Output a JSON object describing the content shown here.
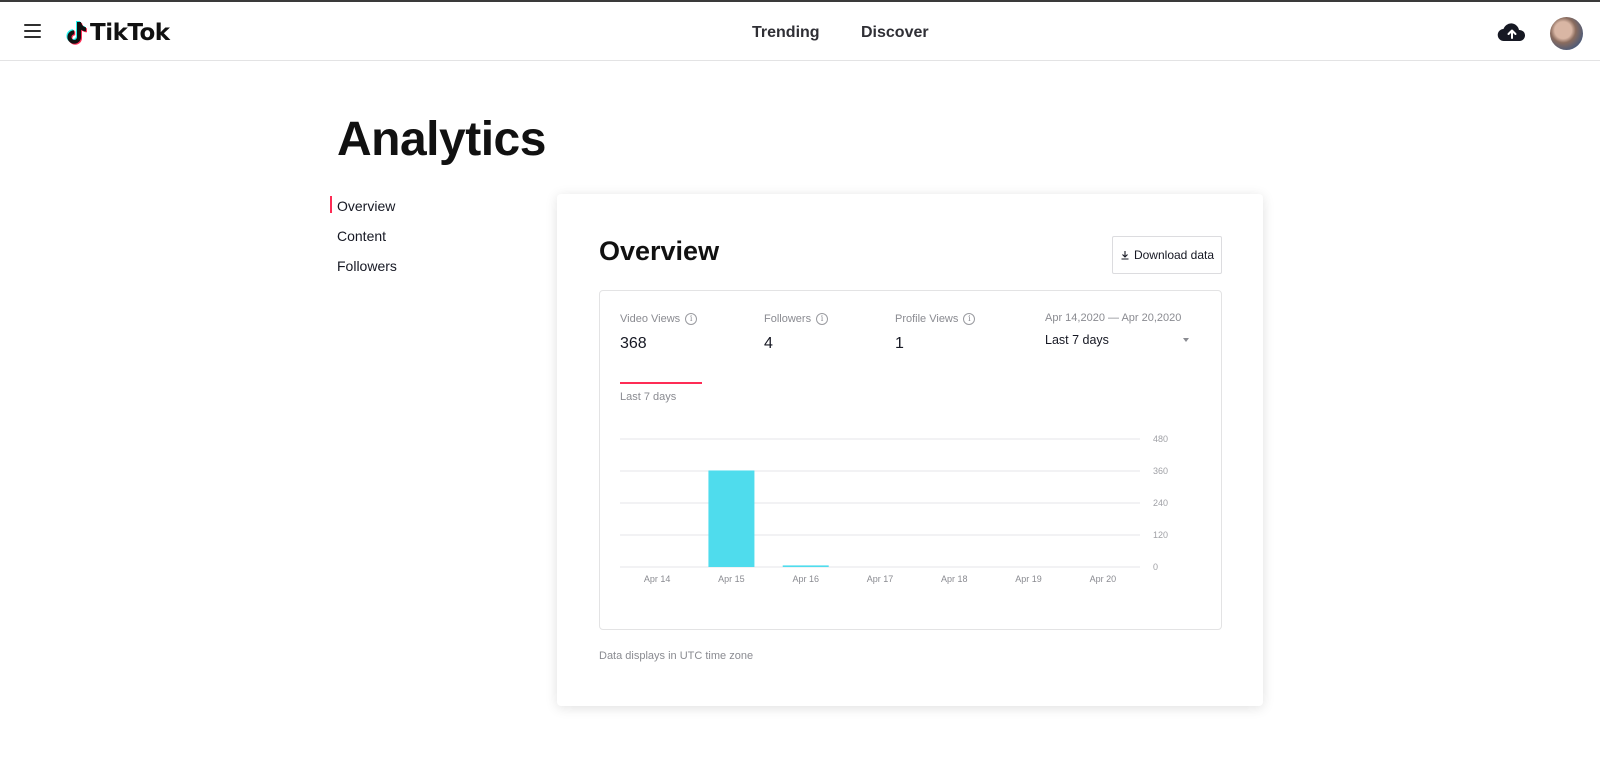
{
  "header": {
    "logo_text": "TikTok",
    "nav": {
      "trending": "Trending",
      "discover": "Discover"
    }
  },
  "page_title": "Analytics",
  "side_nav": {
    "overview": "Overview",
    "content": "Content",
    "followers": "Followers"
  },
  "card": {
    "title": "Overview",
    "download_label": "Download data",
    "metrics": {
      "video_views": {
        "label": "Video Views",
        "value": "368"
      },
      "followers": {
        "label": "Followers",
        "value": "4"
      },
      "profile_views": {
        "label": "Profile Views",
        "value": "1"
      }
    },
    "date_range": {
      "label": "Apr 14,2020 — Apr 20,2020",
      "selected": "Last 7 days"
    },
    "chart_caption": "Last 7 days",
    "footnote": "Data displays in UTC time zone"
  },
  "colors": {
    "accent": "#fe2c55",
    "bar": "#4fdced",
    "grid": "#e6e6e8"
  },
  "chart_data": {
    "type": "bar",
    "categories": [
      "Apr 14",
      "Apr 15",
      "Apr 16",
      "Apr 17",
      "Apr 18",
      "Apr 19",
      "Apr 20"
    ],
    "values": [
      0,
      362,
      6,
      0,
      0,
      0,
      0
    ],
    "yticks": [
      0,
      120,
      240,
      360,
      480
    ],
    "ylim": [
      0,
      480
    ],
    "grid": true
  }
}
